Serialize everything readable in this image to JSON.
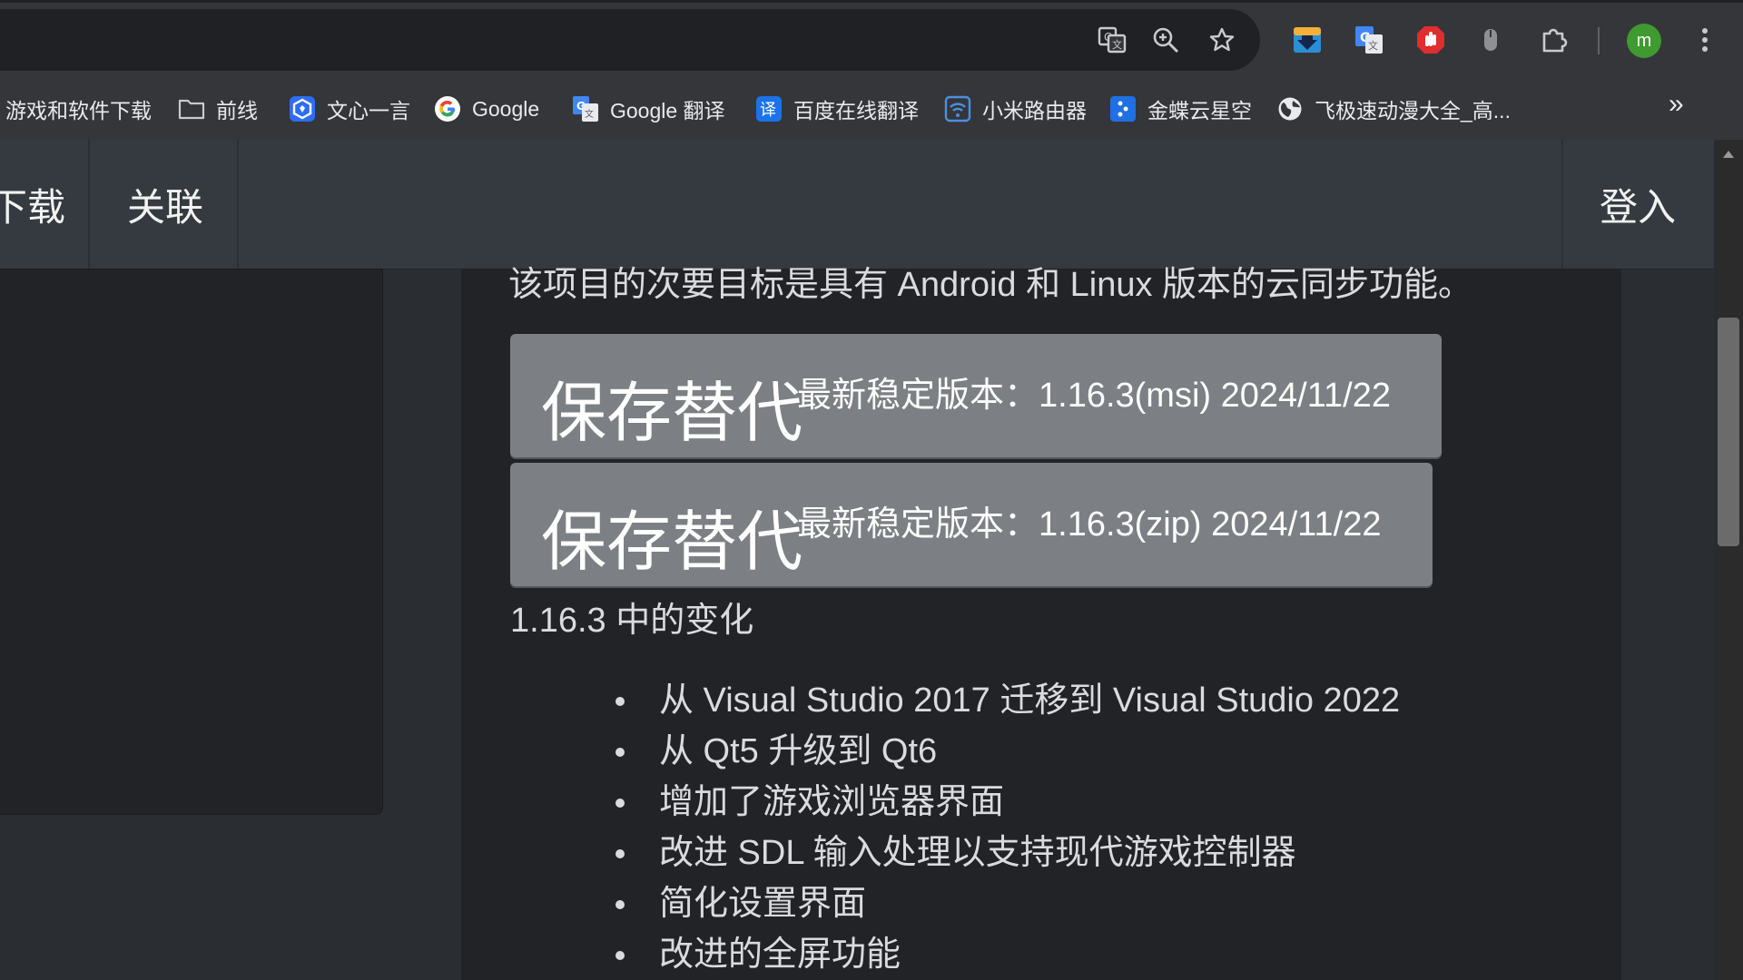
{
  "toolbar": {
    "icons": [
      "translate-page-icon",
      "zoom-icon",
      "bookmark-star-icon",
      "download-extension-icon",
      "google-translate-extension-icon",
      "adblock-extension-icon",
      "mouse-extension-icon",
      "extensions-puzzle-icon",
      "more-menu-icon"
    ],
    "avatar_letter": "m",
    "avatar_color": "#3f9a2f"
  },
  "bookmarks": {
    "items": [
      {
        "label": "游戏和软件下载",
        "icon": "none"
      },
      {
        "label": "前线",
        "icon": "folder-icon"
      },
      {
        "label": "文心一言",
        "icon": "wenxin-icon"
      },
      {
        "label": "Google",
        "icon": "google-icon"
      },
      {
        "label": "Google 翻译",
        "icon": "google-translate-icon"
      },
      {
        "label": "百度在线翻译",
        "icon": "baidu-translate-icon"
      },
      {
        "label": "小米路由器",
        "icon": "wifi-router-icon"
      },
      {
        "label": "金蝶云星空",
        "icon": "kingdee-icon"
      },
      {
        "label": "飞极速动漫大全_高...",
        "icon": "globe-icon"
      }
    ],
    "more": "»"
  },
  "site_nav": {
    "download": "下载",
    "links": "关联",
    "login": "登入"
  },
  "main": {
    "intro": "该项目的次要目标是具有 Android 和 Linux 版本的云同步功能。",
    "downloads": [
      {
        "name": "保存替代",
        "info": "最新稳定版本：1.16.3(msi) 2024/11/22"
      },
      {
        "name": "保存替代",
        "info": "最新稳定版本：1.16.3(zip) 2024/11/22"
      }
    ],
    "changes_title": "1.16.3 中的变化",
    "changes": [
      "从 Visual Studio 2017 迁移到 Visual Studio 2022",
      "从 Qt5 升级到 Qt6",
      "增加了游戏浏览器界面",
      "改进 SDL 输入处理以支持现代游戏控制器",
      "简化设置界面",
      "改进的全屏功能"
    ]
  },
  "colors": {
    "chrome_bg": "#35363a",
    "nav_bg": "#343a40",
    "panel_bg": "#212327",
    "button_bg": "#7c7f83"
  }
}
